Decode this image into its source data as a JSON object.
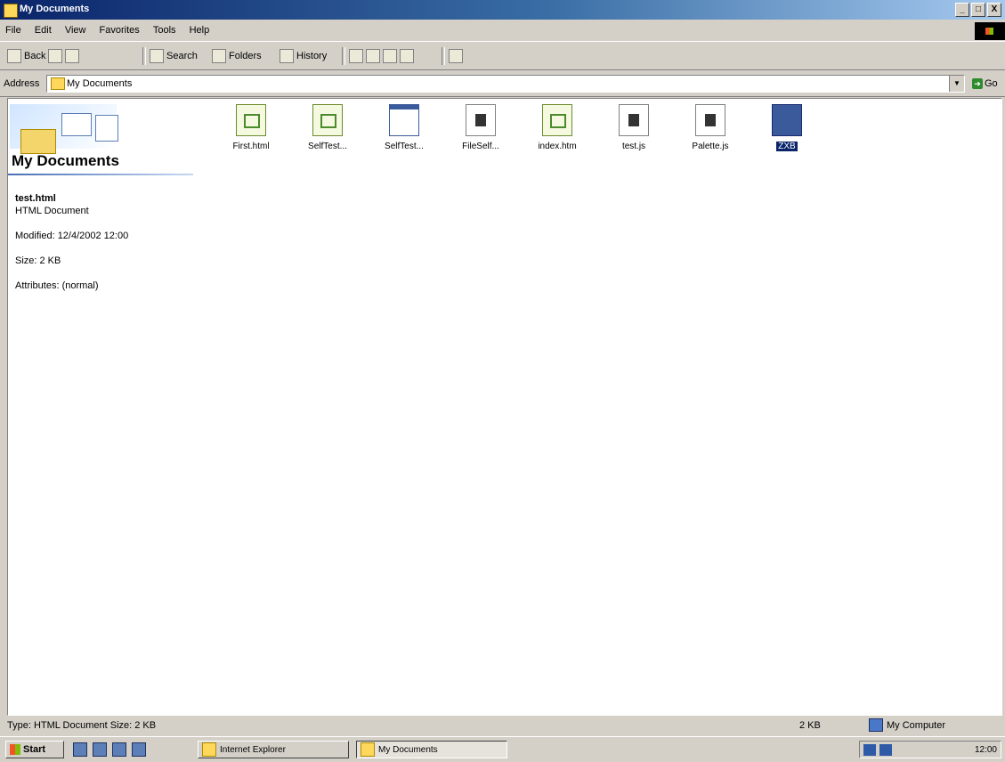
{
  "window": {
    "title": "My Documents",
    "buttons": {
      "minimize": "_",
      "maximize": "□",
      "close": "X"
    }
  },
  "menu": [
    "File",
    "Edit",
    "View",
    "Favorites",
    "Tools",
    "Help"
  ],
  "toolbar": {
    "back": "Back",
    "search": "Search",
    "folders": "Folders",
    "history": "History"
  },
  "address": {
    "label": "Address",
    "value": "My Documents",
    "go": "Go"
  },
  "banner": {
    "title": "My Documents"
  },
  "info": {
    "name": "test.html",
    "type": "HTML Document",
    "modified": "Modified: 12/4/2002 12:00",
    "size": "Size: 2 KB",
    "attributes": "Attributes: (normal)"
  },
  "files": [
    {
      "label": "First.html",
      "icon": "web-page-icon"
    },
    {
      "label": "SelfTest...",
      "icon": "web-page-icon"
    },
    {
      "label": "SelfTest...",
      "icon": "window-icon"
    },
    {
      "label": "FileSelf...",
      "icon": "document-icon"
    },
    {
      "label": "index.htm",
      "icon": "web-page-icon"
    },
    {
      "label": "test.js",
      "icon": "document-icon"
    },
    {
      "label": "Palette.js",
      "icon": "document-icon"
    },
    {
      "label": "ZXB",
      "icon": "selected-file-icon",
      "selected": true
    }
  ],
  "status": {
    "left": "Type: HTML Document Size: 2 KB",
    "size": "2 KB",
    "zone": "My Computer"
  },
  "taskbar": {
    "start": "Start",
    "tasks": [
      {
        "label": "Internet Explorer"
      },
      {
        "label": "My Documents",
        "active": true
      }
    ],
    "clock": "12:00"
  },
  "colors": {
    "titlebar": "#0a246a",
    "selection": "#0a246a",
    "face": "#d4d0c8"
  }
}
